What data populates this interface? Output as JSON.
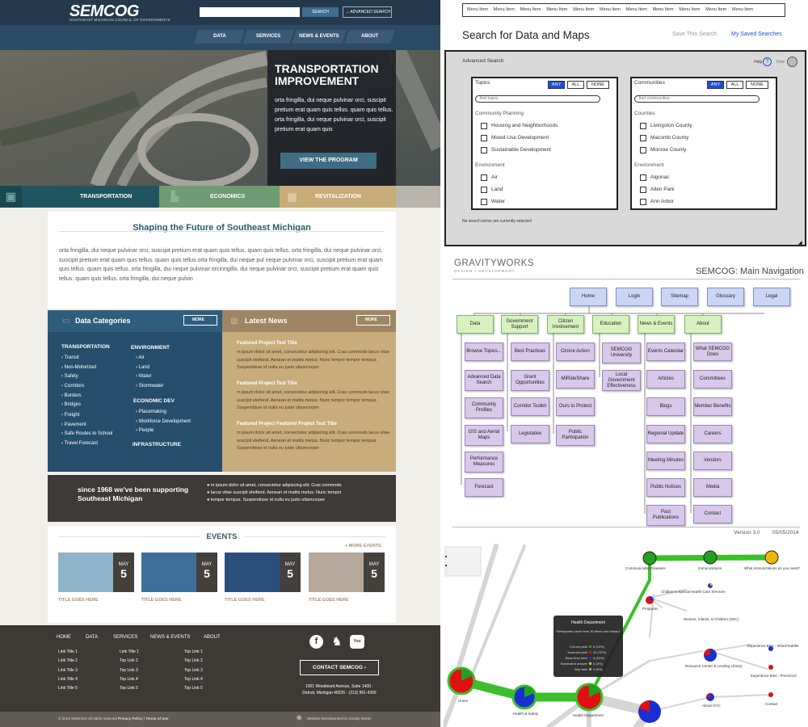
{
  "site": {
    "logo": "SEMCOG",
    "logo_sub": "SOUTHEAST MICHIGAN COUNCIL OF GOVERNMENTS",
    "search_button": "SEARCH",
    "advanced_search": "ADVANCED SEARCH",
    "nav": [
      "DATA",
      "SERVICES",
      "NEWS & EVENTS",
      "ABOUT"
    ],
    "hero": {
      "title": "TRANSPORTATION IMPROVEMENT",
      "body": "orta fringilla, dui neque pulvinar orci, suscipit pretium erat quam quis tellus. quam quis tellus. orta fringilla, dui neque pulvinar orci, suscipit pretium erat quam quis",
      "button": "VIEW THE PROGRAM"
    },
    "tiles": [
      "TRANSPORTATION",
      "ECONOMICS",
      "REVITALIZATION"
    ],
    "tile_colors": [
      "#2f6a72",
      "#6f9b73",
      "#c8ac78"
    ],
    "intro": {
      "title": "Shaping the Future of Southeast Michigan",
      "body": "orta fringilla, dui neque pulvinar orci, suscipit pretium erat quam quis tellus. quam quis tellus. orta fringilla, dui neque pulvinar orci, suscipit pretium erat quam quis tellus. quam quis tellus.orta fringilla, dui neque pul neque pulvinar orci, suscipit pretium erat quam quis tellus. quam quis tellus. orta fringilla, dui neque pulvinar orcinngilla, dui neque pulvinar orci, suscipit pretium erat quam quis tellus. quam quis tellus. orta fringilla, dui neque pulvin"
    },
    "data_categories": {
      "title": "Data Categories",
      "more": "MORE",
      "transportation": {
        "heading": "TRANSPORTATION",
        "items": [
          "Transit",
          "Non-Motorized",
          "Safety",
          "Corridors",
          "Borders",
          "Bridges",
          "Freight",
          "Pavement",
          "Safe Routes to School",
          "Travel Forecast"
        ]
      },
      "environment": {
        "heading": "ENVIRONMENT",
        "items": [
          "Air",
          "Land",
          "Water",
          "Stormwater"
        ]
      },
      "economic": {
        "heading": "ECONOMIC DEV",
        "items": [
          "Placemaking",
          "Workforce Development",
          "People"
        ]
      },
      "infrastructure": {
        "heading": "INFRASTRUCTURE"
      }
    },
    "latest_news": {
      "title": "Latest News",
      "more": "MORE",
      "items": [
        {
          "title": "Featured Project Test Title",
          "body": "m ipsum dolor sit amet, consectetur adipiscing elit. Cras commodo lacus vitae suscipit eleifend. Aenean et mattis metus. Nunc tempor tempor tempus. Suspendisse id nulla eu justo ullamcorper"
        },
        {
          "title": "Featured Project Test Title",
          "body": "m ipsum dolor sit amet, consectetur adipiscing elit. Cras commodo lacus vitae suscipit eleifend. Aenean et mattis metus. Nunc tempor tempor tempus. Suspendisse id nulla eu justo ullamcorper"
        },
        {
          "title": "Featured Project Featured Project Test Title",
          "body": "m ipsum dolor sit amet, consectetur adipiscing elit. Cras commodo lacus vitae suscipit eleifend. Aenean et mattis metus. Nunc tempor tempor tempus. Suspendisse id nulla eu justo ullamcorper"
        }
      ]
    },
    "since": {
      "title": "since 1968 we've been supporting Southeast Michigan",
      "bullets": [
        "m ipsum dolor sit amet, consectetur adipiscing elit. Cras commodo",
        "lacus vitae suscipit eleifend. Aenean et mattis metus. Nunc tempor",
        "tempor tempus. Suspendisse id nulla eu justo ullamcorper"
      ]
    },
    "events": {
      "title": "EVENTS",
      "more": "+ MORE EVENTS",
      "items": [
        {
          "month": "MAY",
          "day": "5",
          "title": "TITLE GOES HERE",
          "color": "#8fb3c9"
        },
        {
          "month": "MAY",
          "day": "5",
          "title": "TITLE GOES HERE",
          "color": "#3d6f9a"
        },
        {
          "month": "MAY",
          "day": "5",
          "title": "TITLE GOES HERE",
          "color": "#2c4e7a"
        },
        {
          "month": "MAY",
          "day": "5",
          "title": "TITLE GOES HERE",
          "color": "#b6a89a"
        }
      ]
    },
    "footer": {
      "nav": [
        "HOME",
        "DATA",
        "SERVICES",
        "NEWS & EVENTS",
        "ABOUT"
      ],
      "col1": [
        "Link Title 1",
        "Link Title 2",
        "Link Title 3",
        "Link Title 4",
        "Link Title 5"
      ],
      "col2": [
        "Link Title 1",
        "Top Link 2",
        "Top Link 3",
        "Top Link 4",
        "Top Link 5"
      ],
      "col3": [
        "Top Link 1",
        "Top Link 2",
        "Top Link 3",
        "Top Link 4",
        "Top Link 5"
      ],
      "contact": "CONTACT SEMCOG",
      "address": "1001 Woodward Avenue, Suite 1400 · Detroit, Michigan 48226 · (313) 961-4266",
      "copyright": "© 2014 SEMCOG All rights reserved",
      "privacy": "Privacy Policy",
      "terms": "Terms of Use",
      "credit": "Website Development by Gravity Works"
    }
  },
  "wireframe": {
    "menu": [
      "Menu Item",
      "Menu Item",
      "Menu Item",
      "Menu Item",
      "Menu Item",
      "Menu Item",
      "Menu Item",
      "Menu Item",
      "Menu Item",
      "Menu Item",
      "Menu Item"
    ],
    "title": "Search for Data and Maps",
    "save_search": "Save This Search",
    "my_saved": "My Saved Searches",
    "advanced": "Advanced Search",
    "help": "Help",
    "hide": "Hide",
    "topics": {
      "label": "Topics",
      "search": "find topics",
      "groups": [
        {
          "name": "Community Planning",
          "items": [
            "Housing and Neighborhoods",
            "Mixed-Use Development",
            "Sustainable Development"
          ]
        },
        {
          "name": "Environment",
          "items": [
            "Air",
            "Land",
            "Water"
          ]
        }
      ]
    },
    "communities": {
      "label": "Communities",
      "search": "find communities",
      "groups": [
        {
          "name": "Counties",
          "items": [
            "Livingston County",
            "Macomb County",
            "Monroe County"
          ]
        },
        {
          "name": "Environment",
          "items": [
            "Algonac",
            "Allen Park",
            "Ann Arbor"
          ]
        }
      ]
    },
    "pills": [
      "ANY",
      "ALL",
      "NONE"
    ],
    "status": "No search terms are currently selected"
  },
  "sitemap": {
    "logo": "GRAVITYWORKS",
    "logo_sub": "DESIGN • DEVELOPMENT",
    "title": "SEMCOG: Main Navigation",
    "top": [
      "Home",
      "Login",
      "Sitemap",
      "Glossary",
      "Legal"
    ],
    "sections": [
      "Data",
      "Government Support",
      "Citizen Involvement",
      "Education",
      "News & Events",
      "About"
    ],
    "data_items": [
      "Browse Topics...",
      "Advanced Data Search",
      "Community Profiles",
      "GIS and Aerial Maps",
      "Performance Measures",
      "Forecast"
    ],
    "gov_items": [
      "Best Practices",
      "Grant Opportunities",
      "Corridor Toolkit",
      "Legislative"
    ],
    "cit_items": [
      "Ozone Action",
      "MiRideShare",
      "Ours to Protect",
      "Public Participation"
    ],
    "edu_items": [
      "SEMCOG University",
      "Local Government Effectiveness"
    ],
    "news_items": [
      "Events Calendar",
      "Articles",
      "Blogs",
      "Regional Update",
      "Meeting Minutes",
      "Public Notices",
      "Past Publications"
    ],
    "about_items": [
      "What SEMCOG Does",
      "Committees",
      "Member Benefits",
      "Careers",
      "Vendors",
      "Media",
      "Contact"
    ],
    "version": "Version 3.0",
    "date": "05/05/2014"
  },
  "graph": {
    "nodes": [
      "Communicable Diseases",
      "Immunizations",
      "What immunizations do you need?",
      "Children's Special Health Care Services",
      "Programs",
      "Women, Infants, & Children (WIC)",
      "Experience Bins - Infant/Toddler",
      "Resource Center & Lending Library",
      "Experience Bins - Preschool",
      "About OYC",
      "Contact",
      "Home",
      "Health & Safety",
      "Health Department"
    ],
    "tooltip": {
      "title": "Health Department",
      "text": "Participants came here 30 times and clicked:",
      "rows": [
        {
          "label": "Correct path",
          "value": "6 (15%)"
        },
        {
          "label": "Incorrect path",
          "value": "24 (70%)"
        },
        {
          "label": "Back from here",
          "value": "4 (15%)"
        },
        {
          "label": "Nominated answer",
          "value": "0 (0%)"
        },
        {
          "label": "Skip task",
          "value": "0 (0%)"
        }
      ]
    },
    "colors": {
      "correct": "#22a022",
      "incorrect": "#e01010",
      "back": "#1a2fd0",
      "nominated": "#f0b800"
    }
  }
}
